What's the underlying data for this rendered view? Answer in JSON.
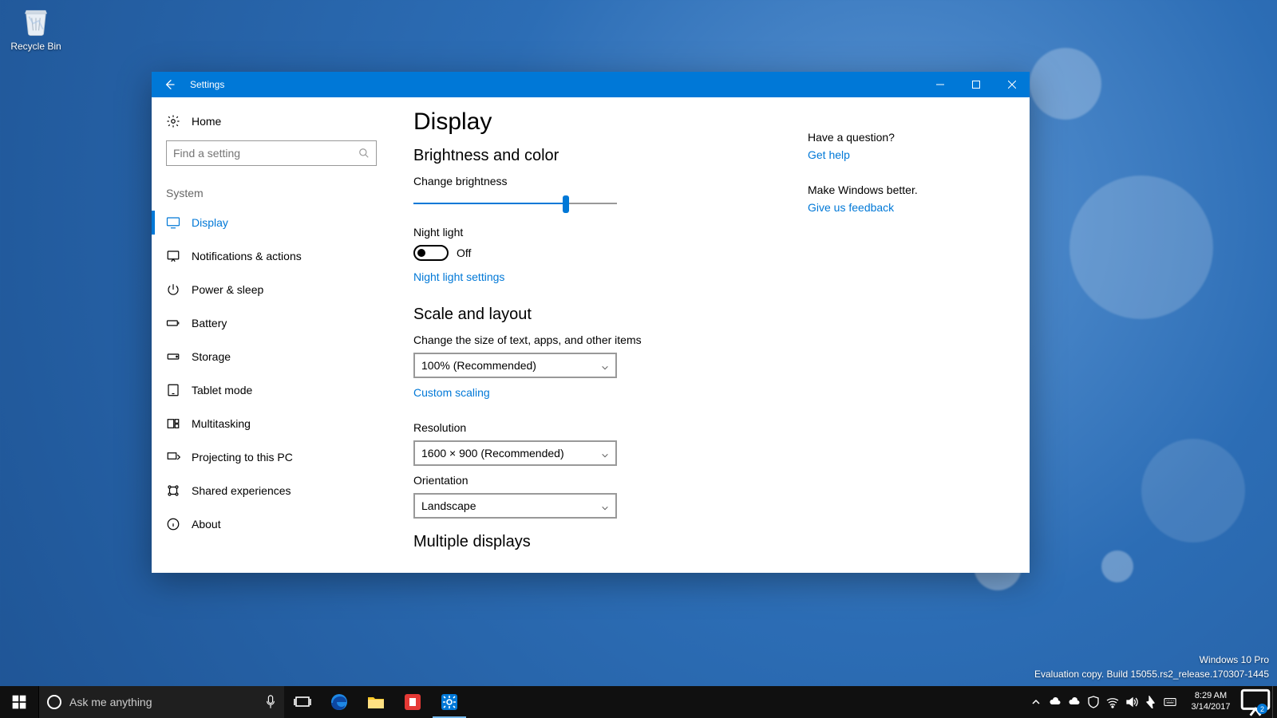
{
  "desktop": {
    "recycle_bin": "Recycle Bin"
  },
  "window": {
    "title": "Settings",
    "home": "Home",
    "search_placeholder": "Find a setting",
    "category": "System",
    "sidebar": [
      {
        "label": "Display",
        "active": true
      },
      {
        "label": "Notifications & actions"
      },
      {
        "label": "Power & sleep"
      },
      {
        "label": "Battery"
      },
      {
        "label": "Storage"
      },
      {
        "label": "Tablet mode"
      },
      {
        "label": "Multitasking"
      },
      {
        "label": "Projecting to this PC"
      },
      {
        "label": "Shared experiences"
      },
      {
        "label": "About"
      }
    ]
  },
  "main": {
    "heading": "Display",
    "brightness_section": "Brightness and color",
    "brightness_label": "Change brightness",
    "brightness_value_percent": 75,
    "night_light_label": "Night light",
    "night_light_state": "Off",
    "night_light_link": "Night light settings",
    "scale_section": "Scale and layout",
    "scale_label": "Change the size of text, apps, and other items",
    "scale_value": "100% (Recommended)",
    "custom_scaling_link": "Custom scaling",
    "resolution_label": "Resolution",
    "resolution_value": "1600 × 900 (Recommended)",
    "orientation_label": "Orientation",
    "orientation_value": "Landscape",
    "multiple_displays_section": "Multiple displays"
  },
  "help": {
    "question": "Have a question?",
    "get_help": "Get help",
    "make_better": "Make Windows better.",
    "feedback": "Give us feedback"
  },
  "watermark": {
    "line1": "Windows 10 Pro",
    "line2": "Evaluation copy. Build 15055.rs2_release.170307-1445"
  },
  "taskbar": {
    "search_placeholder": "Ask me anything",
    "time": "8:29 AM",
    "date": "3/14/2017",
    "notif_count": "2"
  }
}
